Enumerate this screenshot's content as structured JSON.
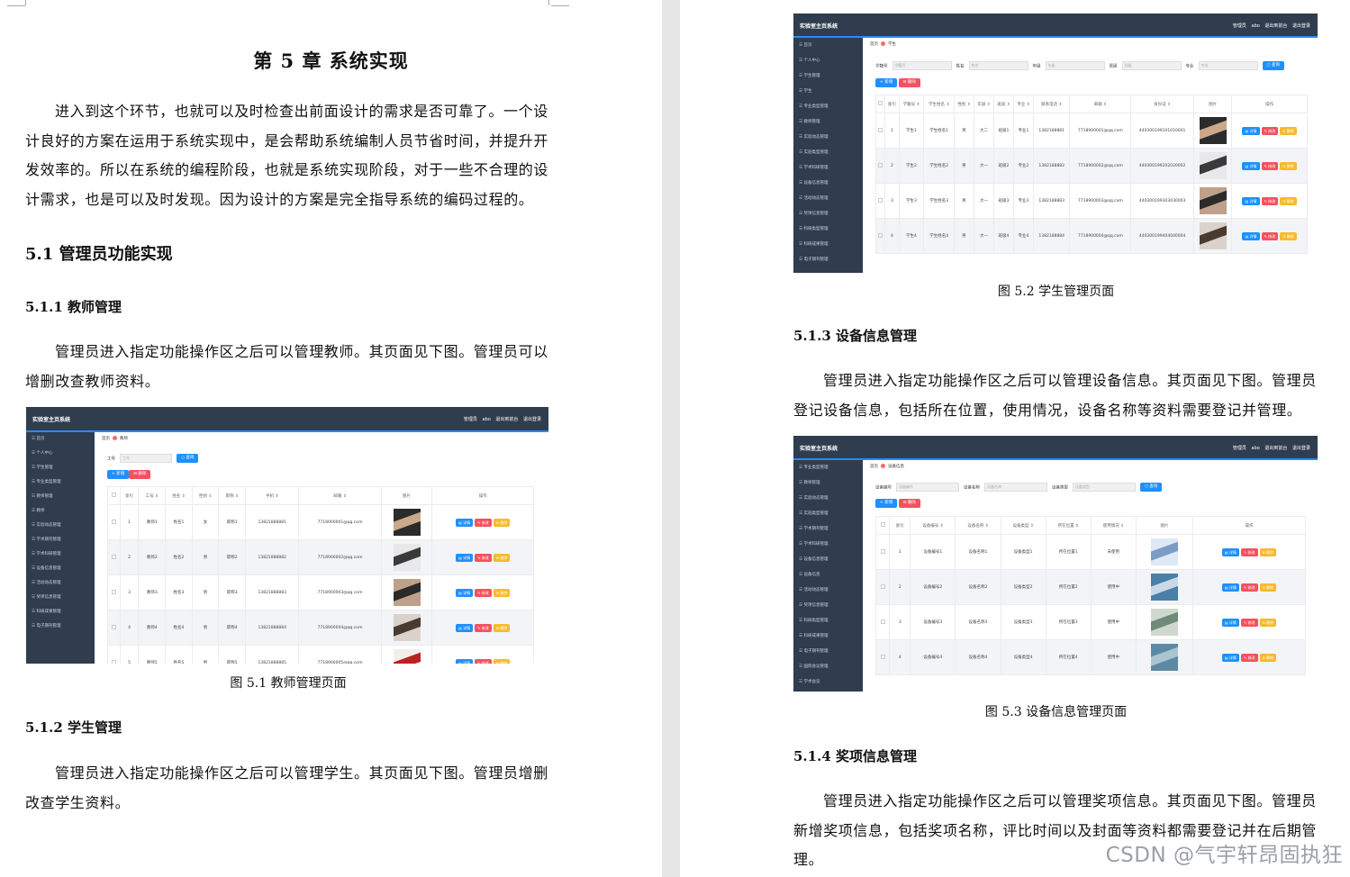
{
  "left": {
    "chapter_title": "第 5 章  系统实现",
    "intro": "进入到这个环节，也就可以及时检查出前面设计的需求是否可靠了。一个设计良好的方案在运用于系统实现中，是会帮助系统编制人员节省时间，并提升开发效率的。所以在系统的编程阶段，也就是系统实现阶段，对于一些不合理的设计需求，也是可以及时发现。因为设计的方案是完全指导系统的编码过程的。",
    "h_5_1": "5.1  管理员功能实现",
    "h_5_1_1": "5.1.1  教师管理",
    "p_5_1_1": "管理员进入指定功能操作区之后可以管理教师。其页面见下图。管理员可以增删改查教师资料。",
    "cap_5_1": "图 5.1  教师管理页面",
    "h_5_1_2": "5.1.2  学生管理",
    "p_5_1_2": "管理员进入指定功能操作区之后可以管理学生。其页面见下图。管理员增删改查学生资料。"
  },
  "right": {
    "cap_5_2": "图 5.2  学生管理页面",
    "h_5_1_3": "5.1.3  设备信息管理",
    "p_5_1_3": "管理员进入指定功能操作区之后可以管理设备信息。其页面见下图。管理员登记设备信息，包括所在位置，使用情况，设备名称等资料需要登记并管理。",
    "cap_5_3": "图 5.3  设备信息管理页面",
    "h_5_1_4": "5.1.4  奖项信息管理",
    "p_5_1_4": "管理员进入指定功能操作区之后可以管理奖项信息。其页面见下图。管理员新增奖项信息，包括奖项名称，评比时间以及封面等资料都需要登记并在后期管理。"
  },
  "shot_common": {
    "app_title": "实验室主页系统",
    "top_right": "管理员 abo  退出到前台  退出登录",
    "home": "首页",
    "search": "查询",
    "add": "新增",
    "del": "删除",
    "detail": "详情",
    "edit": "修改",
    "remove": "删除"
  },
  "shot1": {
    "crumb": "教师",
    "search_label": "工号",
    "search_placeholder": "工号",
    "menu": [
      "首页",
      "个人中心",
      "学生管理",
      "专业类型管理",
      "教师管理",
      "教师",
      "实验动态管理",
      "学术期刊管理",
      "学术科研管理",
      "设备信息管理",
      "活动动态管理",
      "奖项信息管理",
      "科研成果管理",
      "电子期刊管理"
    ],
    "headers": [
      "索引",
      "工号",
      "姓名",
      "性别",
      "职称",
      "手机",
      "邮箱",
      "图片",
      "操作"
    ],
    "rows": [
      [
        "1",
        "教师1",
        "姓名1",
        "女",
        "职称1",
        "13821888881",
        "7718900001@qq.com"
      ],
      [
        "2",
        "教师2",
        "姓名2",
        "男",
        "职称2",
        "13821888882",
        "7718900002@qq.com"
      ],
      [
        "3",
        "教师3",
        "姓名3",
        "男",
        "职称3",
        "13821888883",
        "7718900003@qq.com"
      ],
      [
        "4",
        "教师4",
        "姓名4",
        "男",
        "职称4",
        "13821888884",
        "7718900004@qq.com"
      ],
      [
        "5",
        "教师5",
        "姓名5",
        "男",
        "职称5",
        "13821888885",
        "7718900005@qq.com"
      ]
    ]
  },
  "shot2": {
    "crumb": "学生",
    "search_labels": [
      "学籍号",
      "姓名",
      "年级",
      "班级",
      "专业"
    ],
    "menu": [
      "首页",
      "个人中心",
      "学生管理",
      "学生",
      "专业类型管理",
      "教师管理",
      "实验动态管理",
      "实验类型管理",
      "学术科研管理",
      "设备信息管理",
      "活动动态管理",
      "奖项信息管理",
      "科研类型管理",
      "科研成果管理",
      "电子期刊管理"
    ],
    "headers": [
      "索引",
      "学籍号",
      "学生姓名",
      "性别",
      "年级",
      "班级",
      "专业",
      "联系电话",
      "邮箱",
      "身份证",
      "图片",
      "操作"
    ],
    "rows": [
      [
        "1",
        "学生1",
        "学生姓名1",
        "男",
        "大二",
        "班级1",
        "专业1",
        "1382188881",
        "7718900001@qq.com",
        "440300199101010001"
      ],
      [
        "2",
        "学生2",
        "学生姓名2",
        "男",
        "大一",
        "班级2",
        "专业2",
        "1382188882",
        "7718900002@qq.com",
        "440300199202020002"
      ],
      [
        "3",
        "学生3",
        "学生姓名3",
        "男",
        "大一",
        "班级3",
        "专业3",
        "1382188883",
        "7718900003@qq.com",
        "440300199303030003"
      ],
      [
        "4",
        "学生4",
        "学生姓名4",
        "男",
        "大一",
        "班级4",
        "专业4",
        "1382188884",
        "7718900004@qq.com",
        "440300199404040004"
      ]
    ]
  },
  "shot3": {
    "crumb": "设备信息",
    "search_labels": [
      "设备编号",
      "设备名称",
      "设备类型"
    ],
    "search_placeholders": [
      "设备编号",
      "设备名称",
      "设备类型"
    ],
    "menu": [
      "专业类型管理",
      "教师管理",
      "实验动态管理",
      "实验类型管理",
      "学术期刊管理",
      "学术科研管理",
      "设备信息管理",
      "设备信息",
      "活动动态管理",
      "奖项信息管理",
      "科研类型管理",
      "科研成果管理",
      "电子期刊管理",
      "国际会议管理",
      "学术会议",
      "系统管理"
    ],
    "headers": [
      "索引",
      "设备编号",
      "设备名称",
      "设备类型",
      "所在位置",
      "使用情况",
      "图片",
      "操作"
    ],
    "rows": [
      [
        "1",
        "设备编号1",
        "设备名称1",
        "设备类型1",
        "所在位置1",
        "未使用"
      ],
      [
        "2",
        "设备编号2",
        "设备名称2",
        "设备类型2",
        "所在位置2",
        "使用中"
      ],
      [
        "3",
        "设备编号3",
        "设备名称3",
        "设备类型3",
        "所在位置3",
        "使用中"
      ],
      [
        "4",
        "设备编号4",
        "设备名称4",
        "设备类型4",
        "所在位置4",
        "使用中"
      ]
    ]
  },
  "watermark": "CSDN @气宇轩昂固执狂"
}
